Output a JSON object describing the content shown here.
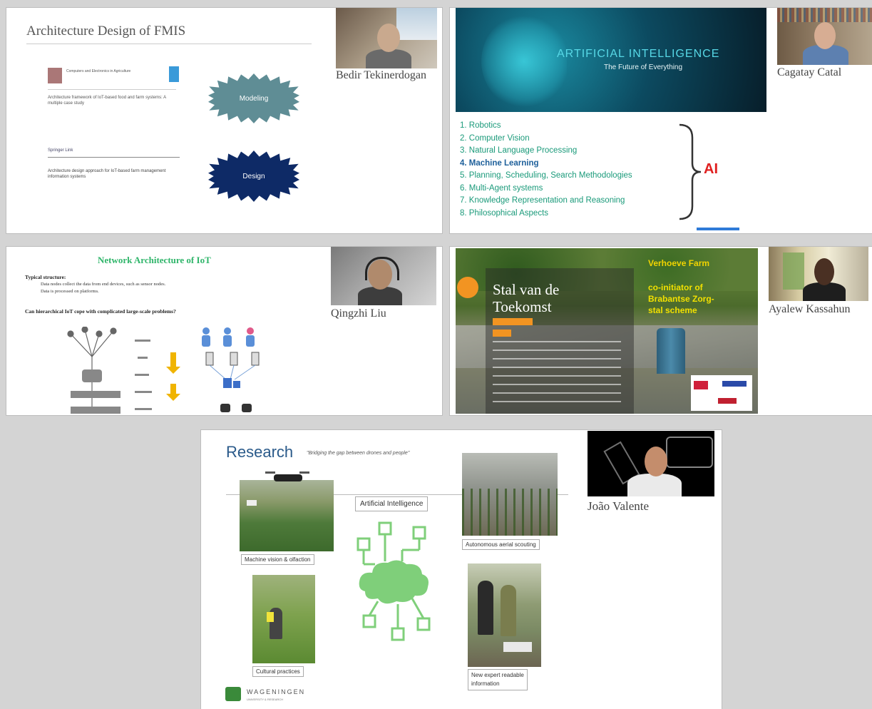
{
  "tiles": {
    "bedir": {
      "slide_title": "Architecture Design of FMIS",
      "paper1_journal": "Computers and Electronics in Agriculture",
      "paper1_title": "Architecture framework of IoT-based food and farm systems: A multiple case study",
      "paper2_publisher": "Springer Link",
      "paper2_title": "Architecture design approach for IoT-based farm management information systems",
      "modeling_label": "Modeling",
      "design_label": "Design",
      "participant_name": "Bedir Tekinerdogan"
    },
    "cagatay": {
      "banner_title": "ARTIFICIAL INTELLIGENCE",
      "banner_subtitle": "The Future of Everything",
      "list": [
        "1.  Robotics",
        "2.  Computer Vision",
        "3.  Natural Language Processing",
        "4.  Machine Learning",
        "5.  Planning, Scheduling, Search Methodologies",
        "6.  Multi-Agent systems",
        "7.  Knowledge Representation and Reasoning",
        "8.  Philosophical Aspects"
      ],
      "brace_label": "AI",
      "participant_name": "Cagatay Catal"
    },
    "qingzhi": {
      "slide_title": "Network Architecture of IoT",
      "bullet1": "Typical structure:",
      "sub1": "Data nodes collect the data from end devices, such as sensor nodes.",
      "sub2": "Data is processed on platforms.",
      "bullet2": "Can hierarchical IoT cope with complicated large-scale problems?",
      "participant_name": "Qingzhi Liu"
    },
    "ayalew": {
      "slide_title_line1": "Stal van de",
      "slide_title_line2": "Toekomst",
      "farm_name": "Verhoeve Farm",
      "overlay_text_line1": "co-initiator of",
      "overlay_text_line2": "Brabantse Zorg-",
      "overlay_text_line3": "stal scheme",
      "participant_name": "Ayalew Kassahun"
    },
    "joao": {
      "slide_title": "Research",
      "slide_subtitle": "\"Bridging the gap between drones and people\"",
      "ai_label": "Artificial Intelligence",
      "caption_machine_vision": "Machine vision & olfaction",
      "caption_autonomous": "Autonomous aerial scouting",
      "caption_cultural": "Cultural practices",
      "caption_expert_line1": "New expert readable",
      "caption_expert_line2": "information",
      "logo_text": "WAGENINGEN",
      "logo_sub": "UNIVERSITY & RESEARCH",
      "participant_name": "João Valente"
    }
  },
  "colors": {
    "background": "#d4d4d4",
    "ai_teal": "#1a9a7a",
    "ai_blue": "#1d5f9a",
    "ai_red": "#e02020",
    "network_green": "#2fb56a",
    "research_green": "#7fcf7a"
  }
}
